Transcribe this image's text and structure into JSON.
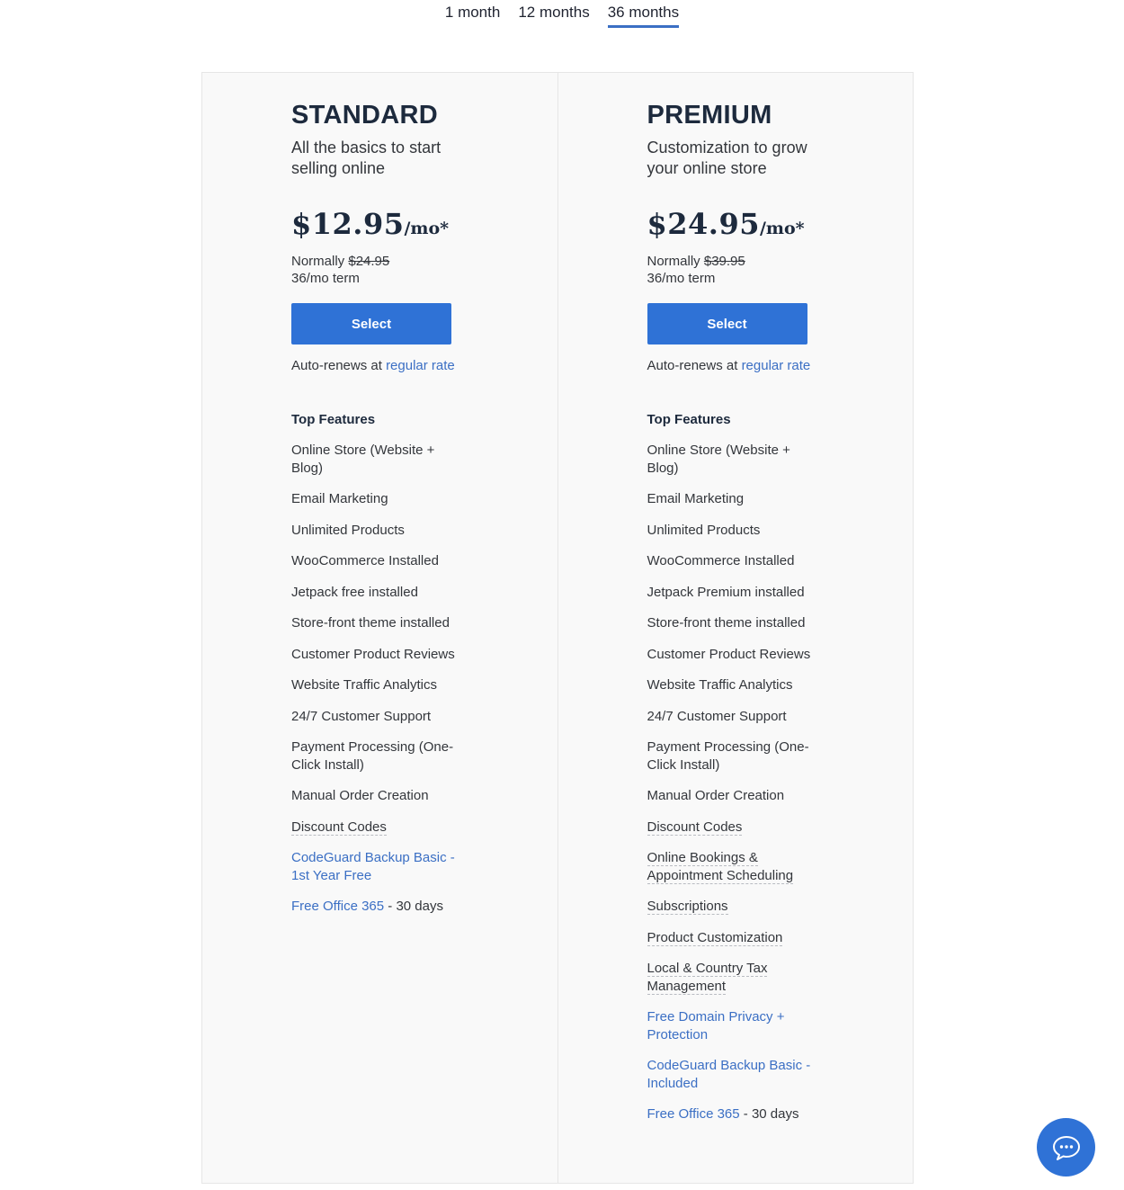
{
  "term_tabs": [
    {
      "label": "1 month",
      "active": false
    },
    {
      "label": "12 months",
      "active": false
    },
    {
      "label": "36 months",
      "active": true
    }
  ],
  "accent_color": "#3b6fc4",
  "button_color": "#2f72d6",
  "plans": [
    {
      "name": "STANDARD",
      "tagline": "All the basics to start selling online",
      "price": "$12.95",
      "price_unit": "/mo*",
      "normally_label": "Normally",
      "normal_price": "$24.95",
      "term": "36/mo term",
      "select_label": "Select",
      "auto_renew_text": "Auto-renews at",
      "auto_renew_link": "regular rate",
      "features_title": "Top Features",
      "features": [
        {
          "text": "Online Store (Website + Blog)",
          "style": "plain"
        },
        {
          "text": "Email Marketing",
          "style": "plain"
        },
        {
          "text": "Unlimited Products",
          "style": "plain"
        },
        {
          "text": "WooCommerce Installed",
          "style": "plain"
        },
        {
          "text": "Jetpack free installed",
          "style": "plain"
        },
        {
          "text": "Store-front theme installed",
          "style": "plain"
        },
        {
          "text": "Customer Product Reviews",
          "style": "plain"
        },
        {
          "text": "Website Traffic Analytics",
          "style": "plain"
        },
        {
          "text": "24/7 Customer Support",
          "style": "plain"
        },
        {
          "text": "Payment Processing (One-Click Install)",
          "style": "plain"
        },
        {
          "text": "Manual Order Creation",
          "style": "plain"
        },
        {
          "text": "Discount Codes",
          "style": "dotted"
        },
        {
          "text": "CodeGuard Backup Basic - 1st Year Free",
          "style": "link"
        },
        {
          "text": "Free Office 365",
          "suffix": " - 30 days",
          "style": "link"
        }
      ]
    },
    {
      "name": "PREMIUM",
      "tagline": "Customization to grow your online store",
      "price": "$24.95",
      "price_unit": "/mo*",
      "normally_label": "Normally",
      "normal_price": "$39.95",
      "term": "36/mo term",
      "select_label": "Select",
      "auto_renew_text": "Auto-renews at",
      "auto_renew_link": "regular rate",
      "features_title": "Top Features",
      "features": [
        {
          "text": "Online Store (Website + Blog)",
          "style": "plain"
        },
        {
          "text": "Email Marketing",
          "style": "plain"
        },
        {
          "text": "Unlimited Products",
          "style": "plain"
        },
        {
          "text": "WooCommerce Installed",
          "style": "plain"
        },
        {
          "text": "Jetpack Premium installed",
          "style": "plain"
        },
        {
          "text": "Store-front theme installed",
          "style": "plain"
        },
        {
          "text": "Customer Product Reviews",
          "style": "plain"
        },
        {
          "text": "Website Traffic Analytics",
          "style": "plain"
        },
        {
          "text": "24/7 Customer Support",
          "style": "plain"
        },
        {
          "text": "Payment Processing (One-Click Install)",
          "style": "plain"
        },
        {
          "text": "Manual Order Creation",
          "style": "plain"
        },
        {
          "text": "Discount Codes",
          "style": "dotted"
        },
        {
          "text": "Online Bookings & Appointment Scheduling",
          "style": "dotted"
        },
        {
          "text": "Subscriptions",
          "style": "dotted"
        },
        {
          "text": "Product Customization",
          "style": "dotted"
        },
        {
          "text": "Local & Country Tax Management",
          "style": "dotted"
        },
        {
          "text": "Free Domain Privacy + Protection",
          "style": "link"
        },
        {
          "text": "CodeGuard Backup Basic - Included",
          "style": "link"
        },
        {
          "text": "Free Office 365",
          "suffix": " - 30 days",
          "style": "link"
        }
      ]
    }
  ],
  "chat": {
    "icon": "chat-bubble-icon"
  }
}
